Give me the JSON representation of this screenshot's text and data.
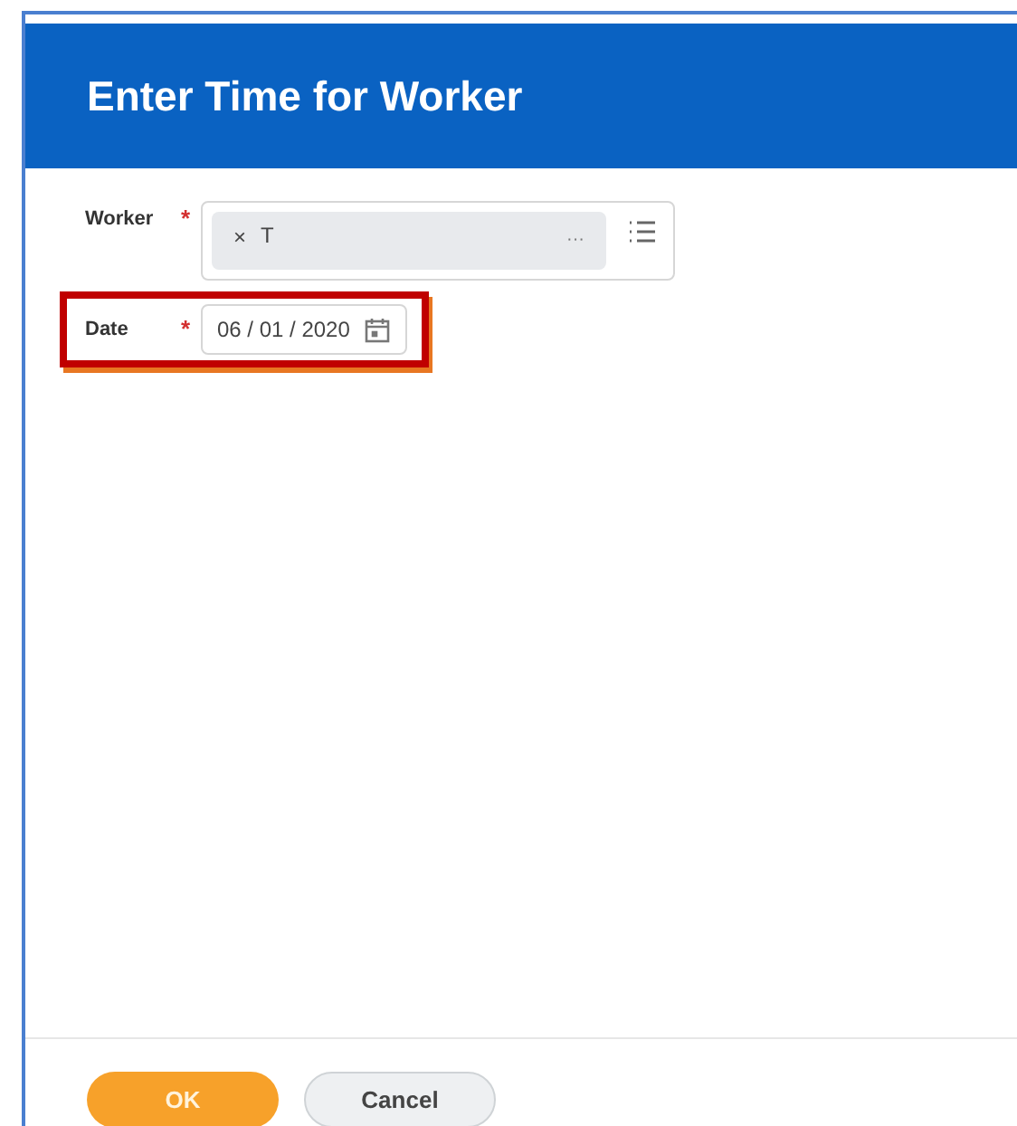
{
  "window": {
    "title": "Enter Time for Worker"
  },
  "fields": [
    {
      "kind": "prompt",
      "label": "Worker",
      "required_mark": "*",
      "clear": "×",
      "value": "T",
      "more": "···",
      "highlighted": false
    },
    {
      "kind": "date",
      "label": "Date",
      "required_mark": "*",
      "value": "06 / 01 / 2020",
      "highlighted": true
    }
  ],
  "buttons": [
    {
      "label": "OK",
      "kind": "primary"
    },
    {
      "label": "Cancel",
      "kind": "secondary"
    }
  ]
}
